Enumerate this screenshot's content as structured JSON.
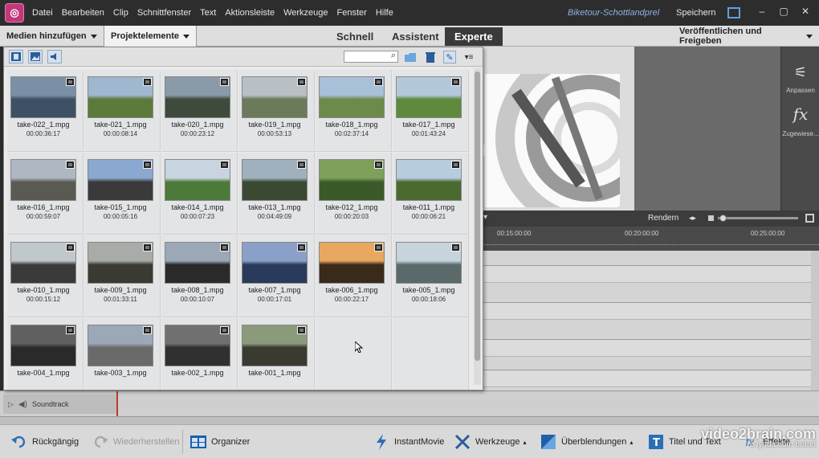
{
  "menu": [
    "Datei",
    "Bearbeiten",
    "Clip",
    "Schnittfenster",
    "Text",
    "Aktionsleiste",
    "Werkzeuge",
    "Fenster",
    "Hilfe"
  ],
  "project_title": "Biketour-Schottlandprel",
  "save_label": "Speichern",
  "panel_tabs": {
    "add_media": "Medien hinzufügen",
    "project_assets": "Projektelemente"
  },
  "mode_tabs": [
    "Schnell",
    "Assistent",
    "Experte"
  ],
  "selected_mode": "Experte",
  "publish_label": "Veröffentlichen und Freigeben",
  "right_panel": {
    "adjust": "Anpassen",
    "applied": "Zugewiese..."
  },
  "timeline": {
    "render": "Rendern",
    "times": [
      "00:15:00:00",
      "00:20:00:00",
      "00:25:00:00"
    ],
    "soundtrack": "Soundtrack"
  },
  "assets": [
    {
      "name": "take-022_1.mpg",
      "duration": "00:00:36:17"
    },
    {
      "name": "take-021_1.mpg",
      "duration": "00:00:08:14"
    },
    {
      "name": "take-020_1.mpg",
      "duration": "00:00:23:12"
    },
    {
      "name": "take-019_1.mpg",
      "duration": "00:00:53:13"
    },
    {
      "name": "take-018_1.mpg",
      "duration": "00:02:37:14"
    },
    {
      "name": "take-017_1.mpg",
      "duration": "00:01:43:24"
    },
    {
      "name": "take-016_1.mpg",
      "duration": "00:00:59:07"
    },
    {
      "name": "take-015_1.mpg",
      "duration": "00:00:05:16"
    },
    {
      "name": "take-014_1.mpg",
      "duration": "00:00:07:23"
    },
    {
      "name": "take-013_1.mpg",
      "duration": "00:04:49:09"
    },
    {
      "name": "take-012_1.mpg",
      "duration": "00:00:20:03"
    },
    {
      "name": "take-011_1.mpg",
      "duration": "00:00:06:21"
    },
    {
      "name": "take-010_1.mpg",
      "duration": "00:00:15:12"
    },
    {
      "name": "take-009_1.mpg",
      "duration": "00:01:33:11"
    },
    {
      "name": "take-008_1.mpg",
      "duration": "00:00:10:07"
    },
    {
      "name": "take-007_1.mpg",
      "duration": "00:00:17:01"
    },
    {
      "name": "take-006_1.mpg",
      "duration": "00:00:22:17"
    },
    {
      "name": "take-005_1.mpg",
      "duration": "00:00:18:06"
    },
    {
      "name": "take-004_1.mpg",
      "duration": ""
    },
    {
      "name": "take-003_1.mpg",
      "duration": ""
    },
    {
      "name": "take-002_1.mpg",
      "duration": ""
    },
    {
      "name": "take-001_1.mpg",
      "duration": ""
    }
  ],
  "actions": {
    "undo": "Rückgängig",
    "redo": "Wiederherstellen",
    "organizer": "Organizer",
    "instant_movie": "InstantMovie",
    "tools": "Werkzeuge",
    "transitions": "Überblendungen",
    "titles": "Titel und Text",
    "effects": "Effekte"
  },
  "watermark": {
    "line1": "video2brain.com",
    "line2": "a lynda.com brand"
  }
}
